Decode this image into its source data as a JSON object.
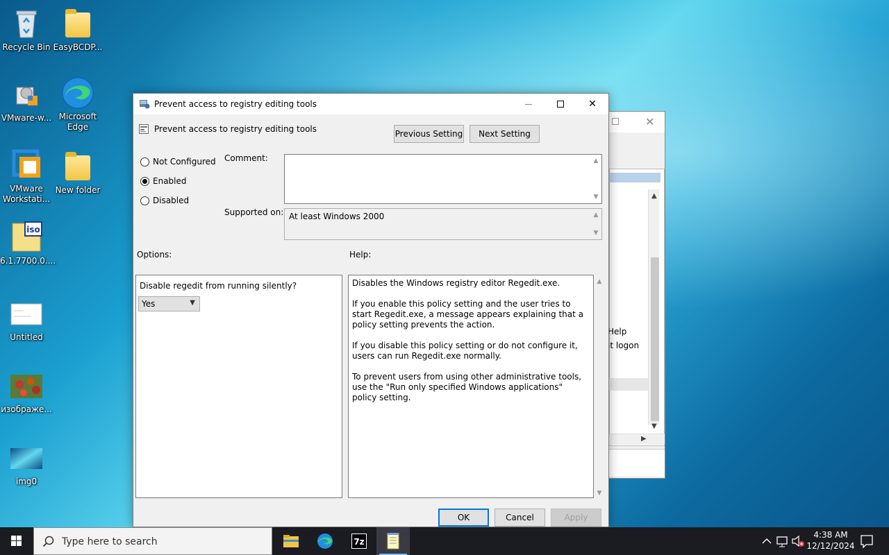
{
  "desktop": {
    "icons": [
      {
        "label": "Recycle Bin"
      },
      {
        "label": "EasyBCDP..."
      },
      {
        "label": "VMware-w..."
      },
      {
        "label": "Microsoft Edge"
      },
      {
        "label": "VMware Workstati..."
      },
      {
        "label": "New folder"
      },
      {
        "label": "6.1.7700.0...."
      },
      {
        "label": "Untitled"
      },
      {
        "label": "изображе..."
      },
      {
        "label": "img0"
      }
    ]
  },
  "background_window": {
    "text_help": "Help",
    "text_logon": "at logon"
  },
  "dialog": {
    "title": "Prevent access to registry editing tools",
    "policy_name": "Prevent access to registry editing tools",
    "prev_button": "Previous Setting",
    "next_button": "Next Setting",
    "radios": [
      {
        "label": "Not Configured",
        "checked": false
      },
      {
        "label": "Enabled",
        "checked": true
      },
      {
        "label": "Disabled",
        "checked": false
      }
    ],
    "comment_label": "Comment:",
    "comment_value": "",
    "supported_label": "Supported on:",
    "supported_value": "At least Windows 2000",
    "options_label": "Options:",
    "help_label": "Help:",
    "option_question": "Disable regedit from running silently?",
    "option_value": "Yes",
    "help_paragraphs": [
      "Disables the Windows registry editor Regedit.exe.",
      "If you enable this policy setting and the user tries to start Regedit.exe, a message appears explaining that a policy setting prevents the action.",
      "If you disable this policy setting or do not configure it, users can run Regedit.exe normally.",
      "To prevent users from using other administrative tools, use the \"Run only specified Windows applications\" policy setting."
    ],
    "ok_button": "OK",
    "cancel_button": "Cancel",
    "apply_button": "Apply"
  },
  "taskbar": {
    "search_placeholder": "Type here to search",
    "time": "4:38 AM",
    "date": "12/12/2024",
    "apps": [
      "file-explorer",
      "edge",
      "7zip",
      "notepad"
    ]
  },
  "colors": {
    "accent": "#0078d7",
    "taskbar": "#1b1b22",
    "dialog_bg": "#f0f0f0"
  }
}
